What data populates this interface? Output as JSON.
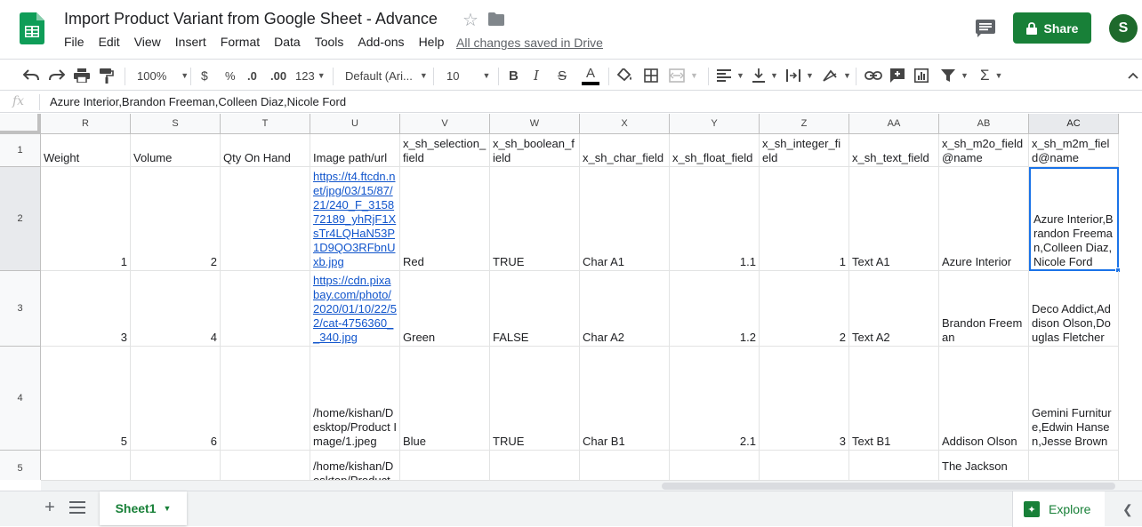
{
  "header": {
    "title": "Import Product Variant from Google Sheet - Advance",
    "saved_status": "All changes saved in Drive",
    "share_label": "Share",
    "avatar_initial": "S"
  },
  "menu": [
    "File",
    "Edit",
    "View",
    "Insert",
    "Format",
    "Data",
    "Tools",
    "Add-ons",
    "Help"
  ],
  "toolbar": {
    "zoom": "100%",
    "currency": "$",
    "percent": "%",
    "decrease_decimal": ".0",
    "increase_decimal": ".00",
    "more_formats": "123",
    "font": "Default (Ari...",
    "font_size": "10",
    "bold": "B",
    "italic": "I",
    "strike": "S",
    "text_color": "A"
  },
  "formula_bar": {
    "fx": "fx",
    "content": "Azure Interior,Brandon Freeman,Colleen Diaz,Nicole Ford"
  },
  "columns": [
    "R",
    "S",
    "T",
    "U",
    "V",
    "W",
    "X",
    "Y",
    "Z",
    "AA",
    "AB",
    "AC"
  ],
  "selected_column": "AC",
  "rows": [
    {
      "label": "1",
      "cells": [
        "Weight",
        "Volume",
        "Qty On Hand",
        "Image path/url",
        "x_sh_selection_field",
        "x_sh_boolean_field",
        "x_sh_char_field",
        "x_sh_float_field",
        "x_sh_integer_field",
        "x_sh_text_field",
        "x_sh_m2o_field@name",
        "x_sh_m2m_field@name"
      ]
    },
    {
      "label": "2",
      "cells": [
        "1",
        "2",
        "",
        "https://t4.ftcdn.net/jpg/03/15/87/21/240_F_315872189_yhRjF1XsTr4LQHaN53P1D9QO3RFbnUxb.jpg",
        "Red",
        "TRUE",
        "Char A1",
        "1.1",
        "1",
        "Text A1",
        "Azure Interior",
        "Azure Interior,Brandon Freeman,Colleen Diaz,Nicole Ford"
      ]
    },
    {
      "label": "3",
      "cells": [
        "3",
        "4",
        "",
        "https://cdn.pixabay.com/photo/2020/01/10/22/52/cat-4756360__340.jpg",
        "Green",
        "FALSE",
        "Char A2",
        "1.2",
        "2",
        "Text A2",
        "Brandon Freeman",
        "Deco Addict,Addison Olson,Douglas Fletcher"
      ]
    },
    {
      "label": "4",
      "cells": [
        "5",
        "6",
        "",
        "/home/kishan/Desktop/Product Image/1.jpeg",
        "Blue",
        "TRUE",
        "Char B1",
        "2.1",
        "3",
        "Text B1",
        "Addison Olson",
        "Gemini Furniture,Edwin Hansen,Jesse Brown"
      ]
    },
    {
      "label": "5",
      "cells": [
        "",
        "",
        "",
        "/home/kishan/Desktop/Product",
        "",
        "",
        "",
        "",
        "",
        "",
        "The Jackson",
        ""
      ]
    }
  ],
  "sheet_tab": "Sheet1",
  "explore_label": "Explore",
  "colors": {
    "brand_green": "#188038",
    "selection_blue": "#1a73e8",
    "link": "#1155cc"
  }
}
